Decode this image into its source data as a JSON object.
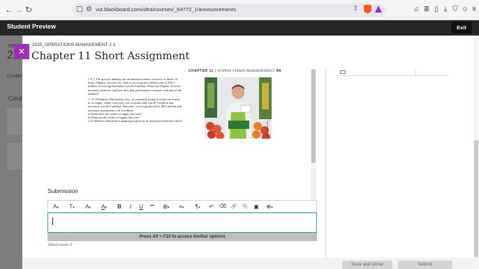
{
  "browser": {
    "url": "vut.blackboard.com/ultra/courses/_64772_1/announcements",
    "icons": [
      "back-icon",
      "forward-icon",
      "reload-icon",
      "bookmark-icon",
      "site-settings-icon",
      "share-icon",
      "brave-shield-icon",
      "brave-rewards-icon",
      "media-icon",
      "reading-list-icon",
      "sidebar-icon",
      "download-icon",
      "vpn-icon",
      "menu-icon"
    ]
  },
  "preview_bar": {
    "title": "Student Preview",
    "exit_label": "Exit"
  },
  "background_page": {
    "course_prefix": "EB",
    "year_prefix": "2",
    "tab_prefix": "Conten",
    "section_prefix": "Cour"
  },
  "modal": {
    "close_glyph": "✕",
    "course_id": "2025_OPERATIONS MANAGEMENT 2.1",
    "title": "Chapter 11 Short Assignment"
  },
  "document": {
    "header_chapter": "CHAPTER 11",
    "header_separator": "|",
    "header_section": "SUPPLY CHAIN MANAGEMENT",
    "header_page": "46",
    "problem_1": "• 11.7     The grocery industry has an annual inventory turnover of about 14 times. Organic Grocers, Inc. had a cost of goods sold last year of $10.5 million; its average inventory was $1.0 million. What was Organic Grocers' inventory turnover, and how does that performance compare with that of the industry?",
    "problem_2": "• • 11.8     Mattress Wholesalers, Inc., is constantly trying to reduce inventory in its supply chain. Last year, cost of goods sold was $7.5 million and inventory was $1.5 million. This year, cost of goods sold is $8.6 million and inventory investment is $1.6 million.",
    "problem_2_a": "a) What were the weeks of supply last year?",
    "problem_2_b": "b) What are the weeks of supply this year?",
    "problem_2_c": "c) Is Mattress Wholesalers making progress in its inventory-reduction effort?",
    "photo_credit": "Peter Dazeley/Getty"
  },
  "submission": {
    "label": "Submission",
    "hint": "Press Alt + F10 to access toolbar options",
    "word_count": "Word count: 0",
    "toolbar": {
      "format": "A",
      "paragraph": "T",
      "font_size": "A",
      "highlight": "A",
      "bold": "B",
      "italic": "I",
      "underline": "U",
      "more": "•••",
      "table": "⊞",
      "align": "≡",
      "pilcrow": "¶",
      "undo": "↶",
      "clear": "⌫",
      "link": "🔗",
      "attach": "📎",
      "image": "▣",
      "add": "⊕",
      "dropdown": "▾"
    }
  },
  "actions": {
    "save_close": "Save and Close",
    "submit": "Submit"
  },
  "colors": {
    "accent_purple": "#9a30b8",
    "focus_teal": "#2f9da4",
    "preview_bar": "#262626"
  }
}
